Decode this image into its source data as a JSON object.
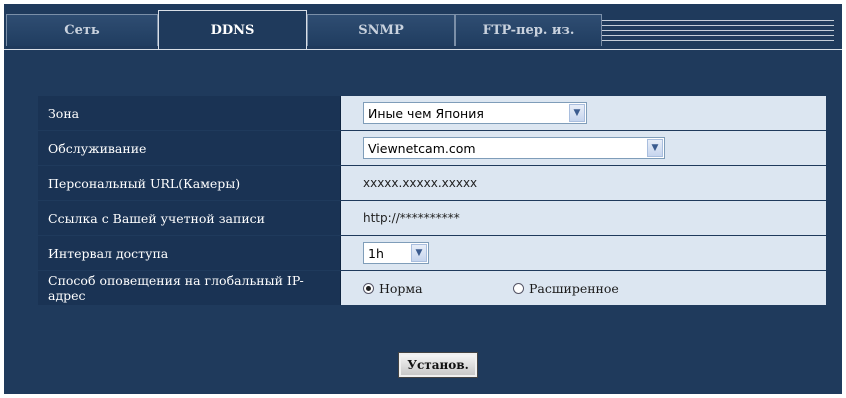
{
  "tabs": [
    {
      "label": "Сеть",
      "active": false
    },
    {
      "label": "DDNS",
      "active": true
    },
    {
      "label": "SNMP",
      "active": false
    },
    {
      "label": "FTP-пер. из.",
      "active": false
    }
  ],
  "form": {
    "zone": {
      "label": "Зона",
      "value": "Иные чем Япония"
    },
    "service": {
      "label": "Обслуживание",
      "value": "Viewnetcam.com"
    },
    "personal_url": {
      "label": "Персональный URL(Камеры)",
      "value": "xxxxx.xxxxx.xxxxx"
    },
    "account_link": {
      "label": "Ссылка с Вашей учетной записи",
      "value": "http://**********"
    },
    "access_interval": {
      "label": "Интервал доступа",
      "value": "1h"
    },
    "global_ip_notify": {
      "label": "Способ оповещения на глобальный IP-адрес",
      "options": [
        "Норма",
        "Расширенное"
      ],
      "selected": "Норма"
    }
  },
  "buttons": {
    "set": "Установ."
  },
  "colors": {
    "frame": "#1f3a5c",
    "label_bg": "#1a3354",
    "value_bg": "#dce6f1"
  },
  "icons": {
    "dropdown": "chevron-down-icon",
    "radio": "radio-icon"
  }
}
